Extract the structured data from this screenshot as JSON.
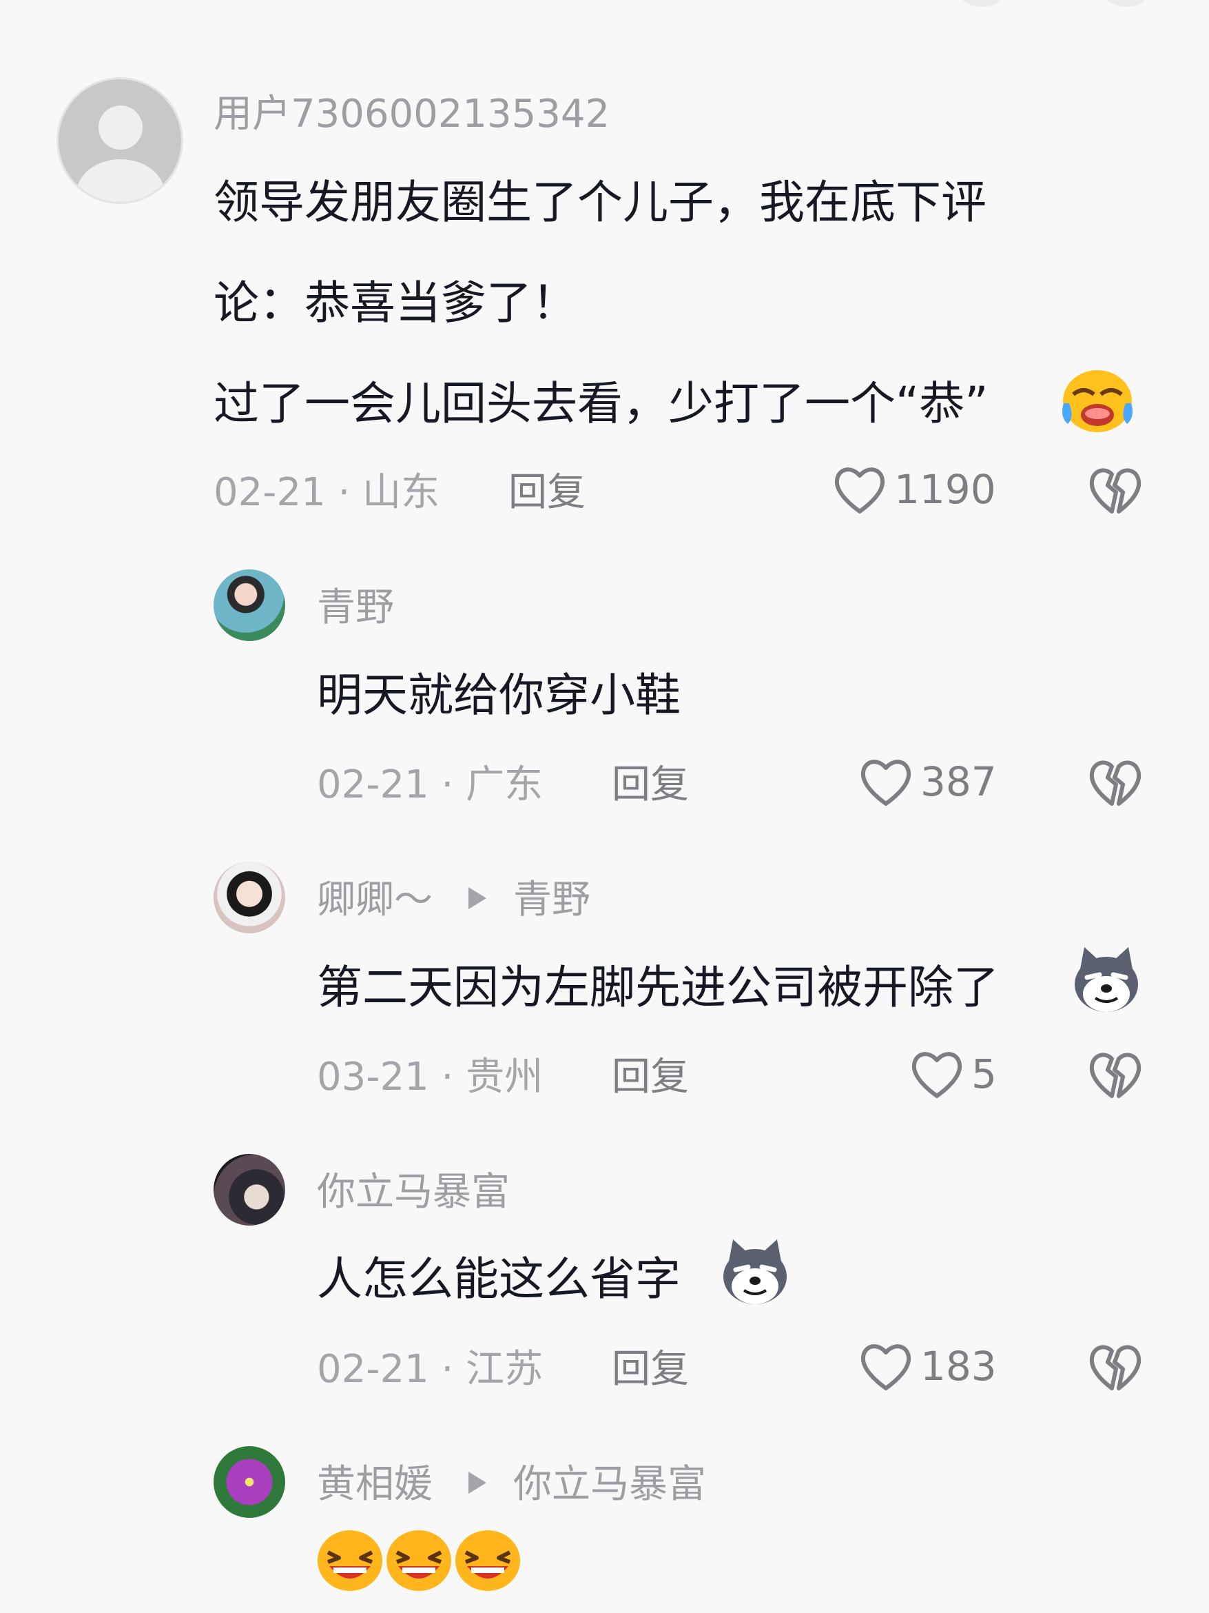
{
  "comments": [
    {
      "user": "用户7306002135342",
      "lines": [
        "领导发朋友圈生了个儿子，我在底下评",
        "论：恭喜当爹了！",
        "过了一会儿回头去看，少打了一个“恭”"
      ],
      "emoji": "crying-face",
      "date": "02-21 · 山东",
      "reply_label": "回复",
      "likes": "1190"
    }
  ],
  "replies": [
    {
      "user": "青野",
      "reply_to": "",
      "text": "明天就给你穿小鞋",
      "emoji": "",
      "date": "02-21 · 广东",
      "reply_label": "回复",
      "likes": "387"
    },
    {
      "user": "卿卿～",
      "reply_to": "青野",
      "text": "第二天因为左脚先进公司被开除了",
      "emoji": "husky-smirk",
      "date": "03-21 · 贵州",
      "reply_label": "回复",
      "likes": "5"
    },
    {
      "user": "你立马暴富",
      "reply_to": "",
      "text": "人怎么能这么省字",
      "emoji": "husky-smirk",
      "date": "02-21 · 江苏",
      "reply_label": "回复",
      "likes": "183"
    },
    {
      "user": "黄相媛",
      "reply_to": "你立马暴富",
      "text": "",
      "emoji": "laughing-face x3",
      "date": "",
      "reply_label": "",
      "likes": ""
    }
  ],
  "icons": {
    "like": "heart-outline-icon",
    "dislike": "broken-heart-icon",
    "reply_arrow": "triangle-arrow-icon"
  },
  "colors": {
    "background": "#f8f8f8",
    "username": "#9d9ea3",
    "body_text": "#161823",
    "meta": "#a4a5aa",
    "action": "#7d7e83"
  }
}
